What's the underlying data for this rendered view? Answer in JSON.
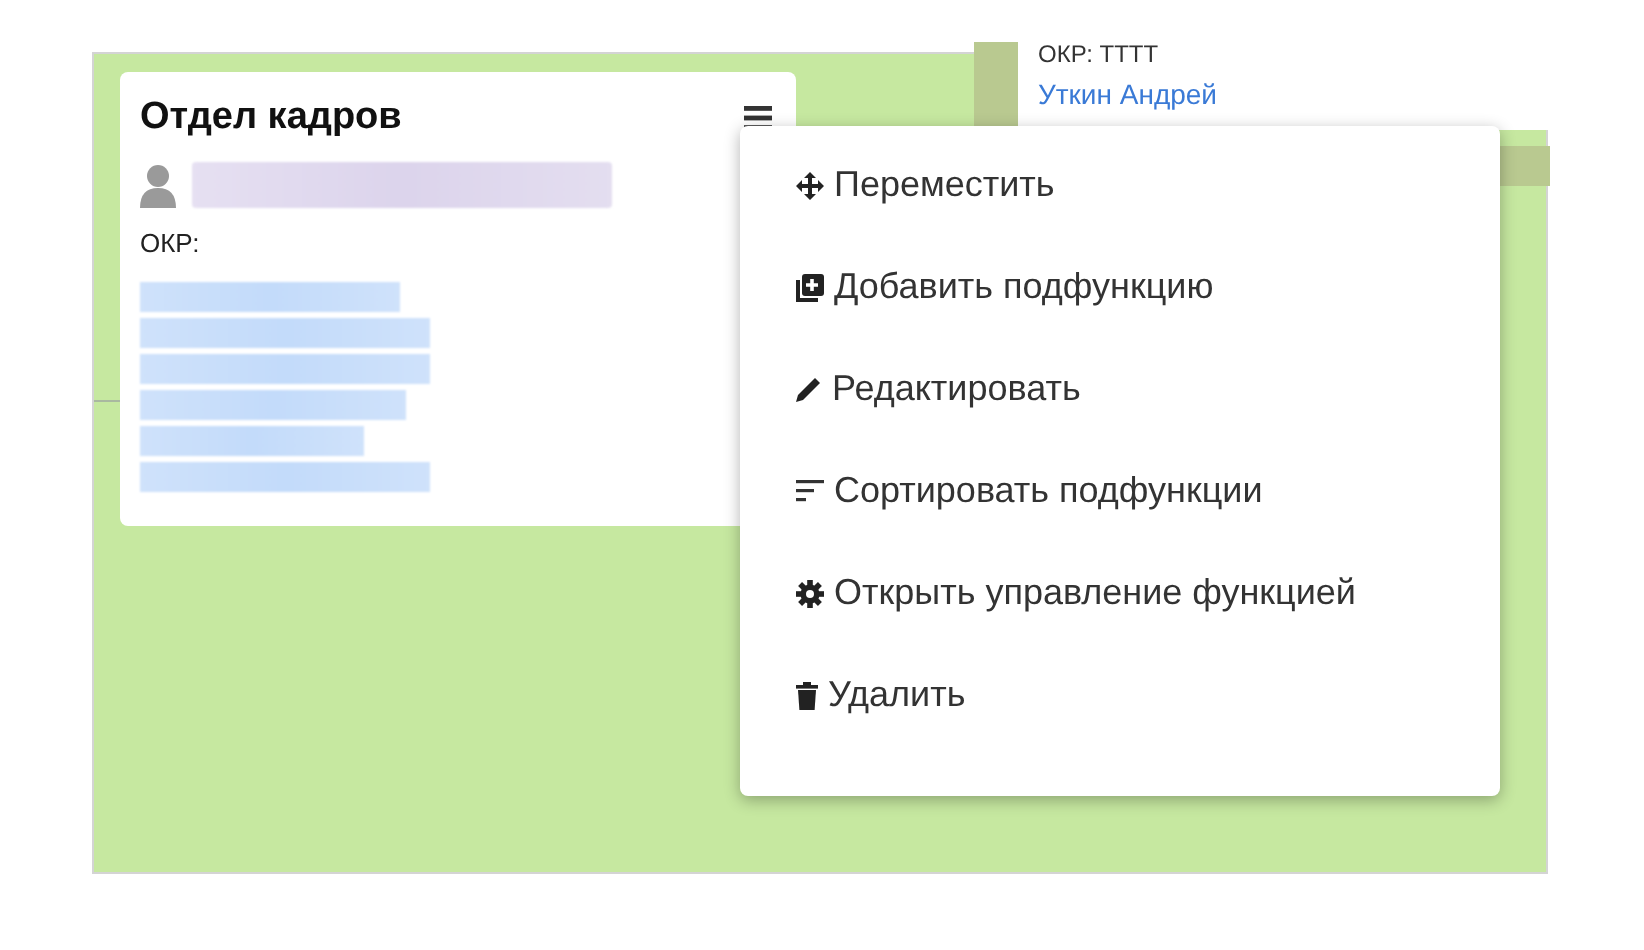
{
  "card": {
    "title": "Отдел кадров",
    "okr_label": "ОКР:"
  },
  "neighbor_card": {
    "okr_text": "ОКР: ТТТТ",
    "person_link": "Уткин Андрей"
  },
  "context_menu": {
    "items": [
      {
        "kind": "move",
        "label": "Переместить"
      },
      {
        "kind": "add",
        "label": "Добавить подфункцию"
      },
      {
        "kind": "edit",
        "label": "Редактировать"
      },
      {
        "kind": "sort",
        "label": "Сортировать подфункции"
      },
      {
        "kind": "settings",
        "label": "Открыть управление функцией"
      },
      {
        "kind": "delete",
        "label": "Удалить"
      }
    ]
  }
}
